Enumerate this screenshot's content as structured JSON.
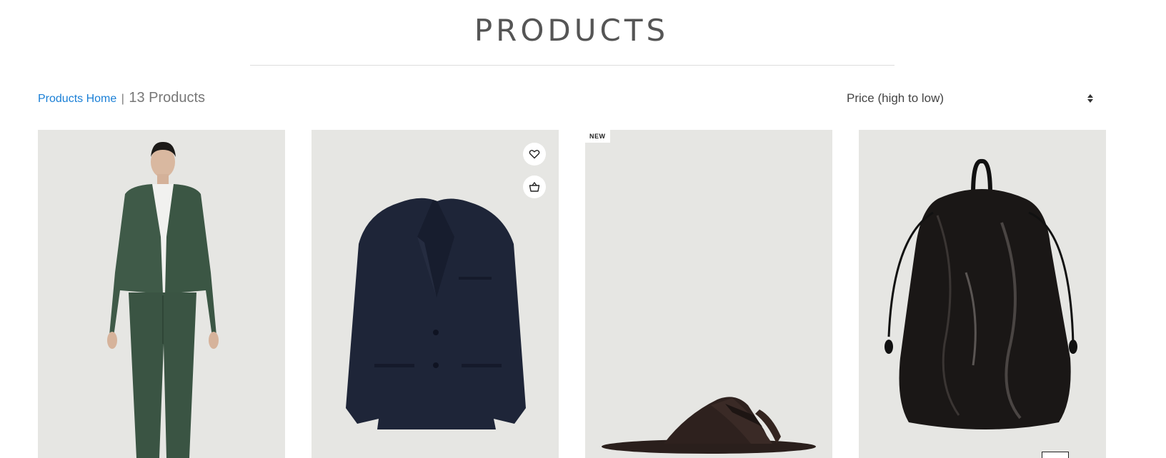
{
  "page": {
    "title": "PRODUCTS"
  },
  "breadcrumb": {
    "home_label": "Products Home",
    "separator": "|",
    "count_label": "13 Products"
  },
  "sort": {
    "selected": "Price (high to low)"
  },
  "products": [
    {
      "image": "green-suit-model",
      "badge": ""
    },
    {
      "image": "navy-blazer",
      "badge": "",
      "actions": [
        "heart-icon",
        "basket-icon"
      ]
    },
    {
      "image": "leather-sandal",
      "badge": "NEW"
    },
    {
      "image": "black-leather-drawstring-bag",
      "badge": ""
    }
  ],
  "colors": {
    "link": "#1a7fd6",
    "card_bg": "#e8e8e5",
    "title": "#555555"
  }
}
